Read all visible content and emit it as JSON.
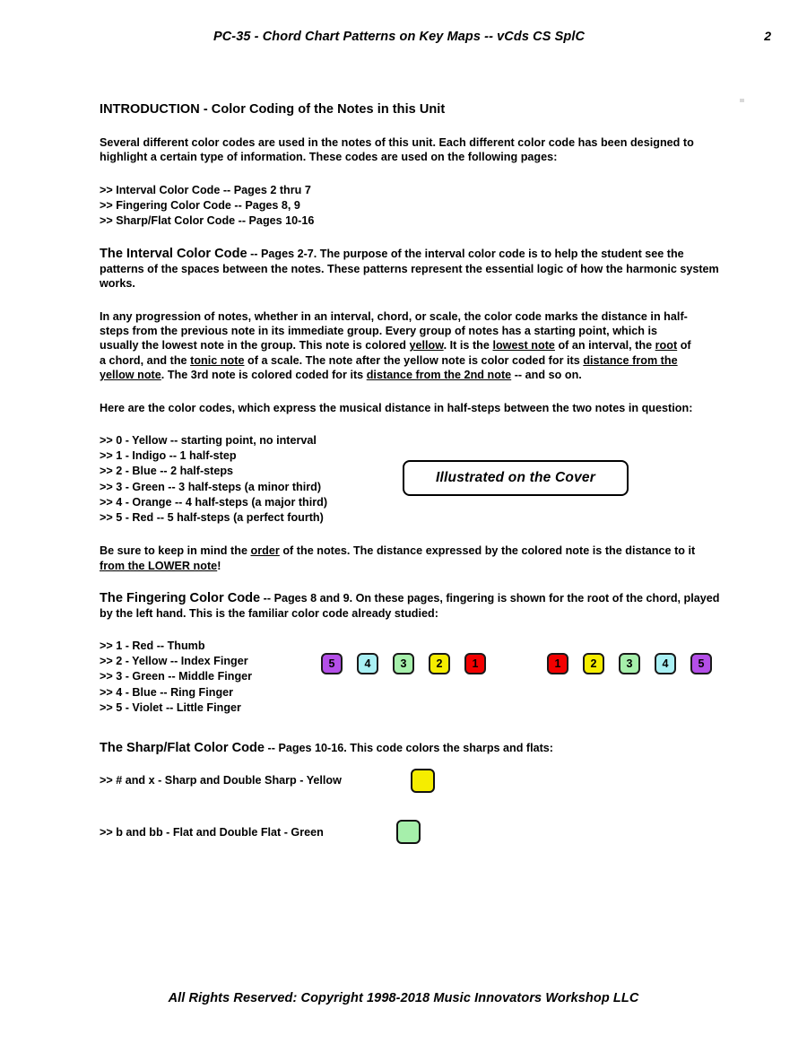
{
  "header": {
    "title": "PC-35 - Chord Chart Patterns on Key Maps -- vCds CS SplC",
    "page_number": "2"
  },
  "intro": {
    "heading": "INTRODUCTION - Color Coding of the Notes in this Unit",
    "paragraph": "Several different color codes are used in the notes of this unit. Each different color code has been designed to highlight a certain type of information. These codes are used on the following pages:",
    "code_index": [
      ">> Interval Color Code -- Pages 2 thru 7",
      ">> Fingering Color Code -- Pages 8, 9",
      ">> Sharp/Flat Color Code -- Pages 10-16"
    ]
  },
  "interval_section": {
    "title": "The Interval Color Code",
    "title_rest": " -- Pages 2-7.  The purpose of the interval color code is to help the student see the patterns of the spaces between the notes. These patterns represent the essential logic of how the harmonic system works.",
    "body_1a": "In any progression of notes, whether in an interval, chord, or scale, the color code marks the distance in half-steps from the previous note in its immediate group. Every group of notes has a starting point, which is usually the lowest note in the group.  This note is colored ",
    "u_yellow": "yellow",
    "body_1b": ". It is the ",
    "u_lowest_note": "lowest note",
    "body_1c": " of an interval, the ",
    "u_root": "root",
    "body_1d": " of a chord, and the ",
    "u_tonic_note": "tonic note",
    "body_1e": " of a scale.  The note after the yellow note is color coded for its ",
    "u_distance_yellow": "distance from the yellow note",
    "body_1f": ".  The 3rd note is colored coded for its ",
    "u_distance_2nd": "distance from the 2nd note",
    "body_1g": " -- and so on.",
    "body_2": "Here are the color codes, which express the musical distance in half-steps between the two notes in question:",
    "codes": [
      ">> 0 - Yellow -- starting point, no interval",
      ">> 1 - Indigo -- 1 half-step",
      ">> 2 - Blue -- 2 half-steps",
      ">> 3 - Green -- 3 half-steps (a minor third)",
      ">> 4 - Orange -- 4 half-steps (a major third)",
      ">> 5 - Red -- 5 half-steps (a perfect fourth)"
    ],
    "callout": "Illustrated on the Cover",
    "note_a": "Be sure to keep in mind the ",
    "note_u1": "order",
    "note_b": " of the notes.  The distance expressed by the colored note is the distance to it ",
    "note_u2": "from the LOWER note",
    "note_c": "!"
  },
  "fingering_section": {
    "title": "The Fingering Color Code",
    "title_rest": " -- Pages 8 and 9.  On these pages, fingering is shown for the root of the chord, played by the left hand. This is the familiar color code already studied:",
    "codes": [
      ">> 1 - Red -- Thumb",
      ">> 2 - Yellow -- Index Finger",
      ">> 3 - Green -- Middle Finger",
      ">> 4 - Blue -- Ring Finger",
      ">> 5 - Violet -- Little Finger"
    ],
    "chips_left": [
      {
        "label": "5",
        "color": "#b44fe8"
      },
      {
        "label": "4",
        "color": "#a9f0f4"
      },
      {
        "label": "3",
        "color": "#a6efab"
      },
      {
        "label": "2",
        "color": "#f5ed00"
      },
      {
        "label": "1",
        "color": "#f20000"
      }
    ],
    "chips_right": [
      {
        "label": "1",
        "color": "#f20000"
      },
      {
        "label": "2",
        "color": "#f5ed00"
      },
      {
        "label": "3",
        "color": "#a6efab"
      },
      {
        "label": "4",
        "color": "#a9f0f4"
      },
      {
        "label": "5",
        "color": "#b44fe8"
      }
    ]
  },
  "sharpflat_section": {
    "title": "The Sharp/Flat Color Code",
    "title_rest": " -- Pages 10-16. This code colors the sharps and flats:",
    "sharp_line": ">> # and x - Sharp and Double Sharp - Yellow",
    "sharp_color": "#f5ed00",
    "flat_line": ">> b and bb - Flat and Double Flat - Green",
    "flat_color": "#a6efab"
  },
  "footer": {
    "text": "All Rights Reserved:  Copyright 1998-2018   Music Innovators Workshop LLC"
  }
}
